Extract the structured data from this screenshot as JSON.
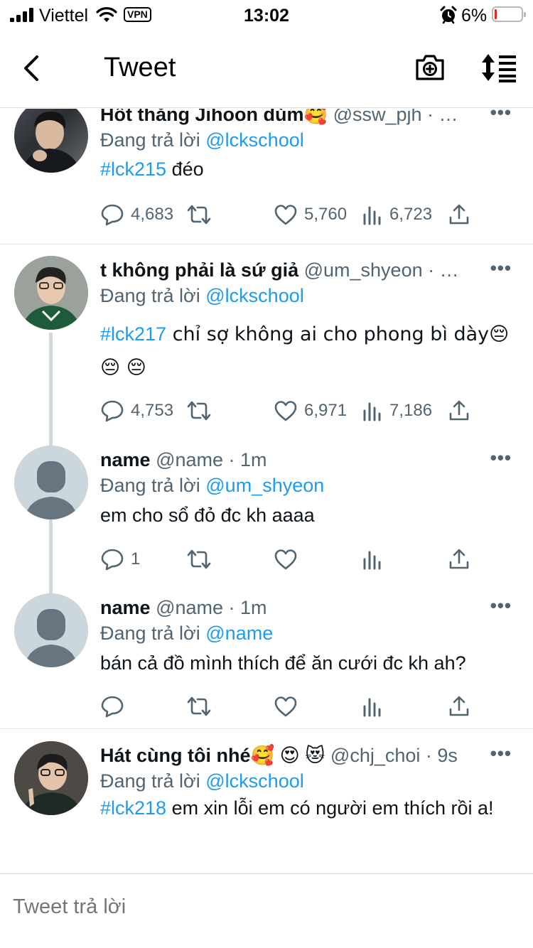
{
  "status_bar": {
    "carrier": "Viettel",
    "vpn": "VPN",
    "time": "13:02",
    "battery": "6%"
  },
  "nav": {
    "title": "Tweet"
  },
  "tweets": [
    {
      "name": "Hốt thằng Jihoon dùm🥰",
      "handle": "@ssw_pjh · …",
      "replying_prefix": "Đang trả lời ",
      "replying_to": "@lckschool",
      "hashtag": "#lck215",
      "text": " đéo",
      "replies": "4,683",
      "retweets": "",
      "likes": "5,760",
      "views": "6,723"
    },
    {
      "name": "t không phải là sứ giả",
      "handle": "@um_shyeon · …",
      "replying_prefix": "Đang trả lời ",
      "replying_to": "@lckschool",
      "hashtag": "#lck217",
      "text": " chỉ sợ không ai cho phong bì dày😔 😔 😔",
      "replies": "4,753",
      "retweets": "",
      "likes": "6,971",
      "views": "7,186"
    },
    {
      "name": "name",
      "handle": "@name · 1m",
      "replying_prefix": "Đang trả lời ",
      "replying_to": "@um_shyeon",
      "hashtag": "",
      "text": "em cho sổ đỏ đc kh aaaa",
      "replies": "1",
      "retweets": "",
      "likes": "",
      "views": ""
    },
    {
      "name": "name",
      "handle": "@name · 1m",
      "replying_prefix": "Đang trả lời ",
      "replying_to": "@name",
      "hashtag": "",
      "text": "bán cả đồ mình thích để ăn cưới đc kh ah?",
      "replies": "",
      "retweets": "",
      "likes": "",
      "views": ""
    },
    {
      "name": "Hát cùng tôi nhé🥰 😍 😻",
      "handle": "@chj_choi · 9s",
      "replying_prefix": "Đang trả lời ",
      "replying_to": "@lckschool",
      "hashtag": "#lck218",
      "text": " em xin lỗi em có người em thích rồi a!",
      "replies": "",
      "retweets": "",
      "likes": "",
      "views": ""
    }
  ],
  "more_glyph": "•••",
  "reply_bar": {
    "placeholder": "Tweet trả lời"
  },
  "colors": {
    "accent": "#1d9bf0",
    "secondary_text": "#536471",
    "thread_line": "#cfd9de",
    "battery_low": "#e0271a"
  }
}
